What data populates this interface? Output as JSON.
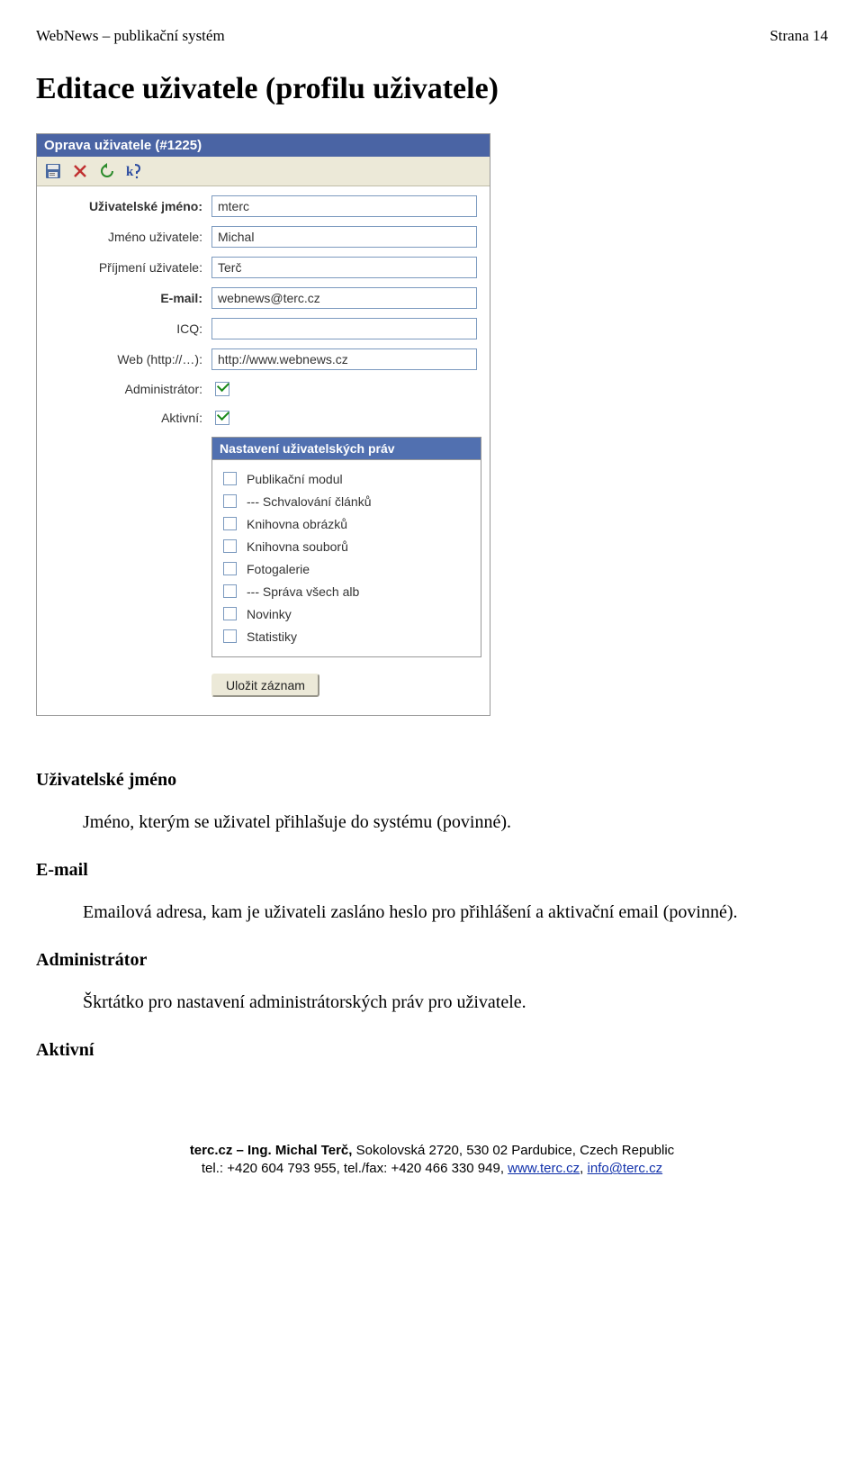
{
  "header": {
    "left": "WebNews – publikační systém",
    "right": "Strana 14"
  },
  "section_title": "Editace uživatele (profilu uživatele)",
  "panel": {
    "title": "Oprava uživatele (#1225)",
    "fields": {
      "username_label": "Uživatelské jméno:",
      "username_value": "mterc",
      "firstname_label": "Jméno uživatele:",
      "firstname_value": "Michal",
      "lastname_label": "Příjmení uživatele:",
      "lastname_value": "Terč",
      "email_label": "E-mail:",
      "email_value": "webnews@terc.cz",
      "icq_label": "ICQ:",
      "icq_value": "",
      "web_label": "Web (http://…):",
      "web_value": "http://www.webnews.cz",
      "admin_label": "Administrátor:",
      "active_label": "Aktivní:"
    },
    "rights_title": "Nastavení uživatelských práv",
    "rights": [
      "Publikační modul",
      "--- Schvalování článků",
      "Knihovna obrázků",
      "Knihovna souborů",
      "Fotogalerie",
      "--- Správa všech alb",
      "Novinky",
      "Statistiky"
    ],
    "submit_label": "Uložit záznam"
  },
  "descriptions": {
    "h1": "Uživatelské jméno",
    "t1": "Jméno, kterým se uživatel přihlašuje do systému (povinné).",
    "h2": "E-mail",
    "t2": "Emailová adresa, kam je uživateli zasláno heslo pro přihlášení a aktivační email (povinné).",
    "h3": "Administrátor",
    "t3": "Škrtátko pro nastavení administrátorských práv pro uživatele.",
    "h4": "Aktivní"
  },
  "footer": {
    "line1_prefix": "terc.cz – Ing. Michal Terč, ",
    "line1_rest": "Sokolovská 2720, 530 02 Pardubice, Czech Republic",
    "line2_prefix": "tel.: +420 604 793 955, tel./fax: +420 466 330 949, ",
    "link1": "www.terc.cz",
    "sep": ", ",
    "link2": "info@terc.cz"
  }
}
